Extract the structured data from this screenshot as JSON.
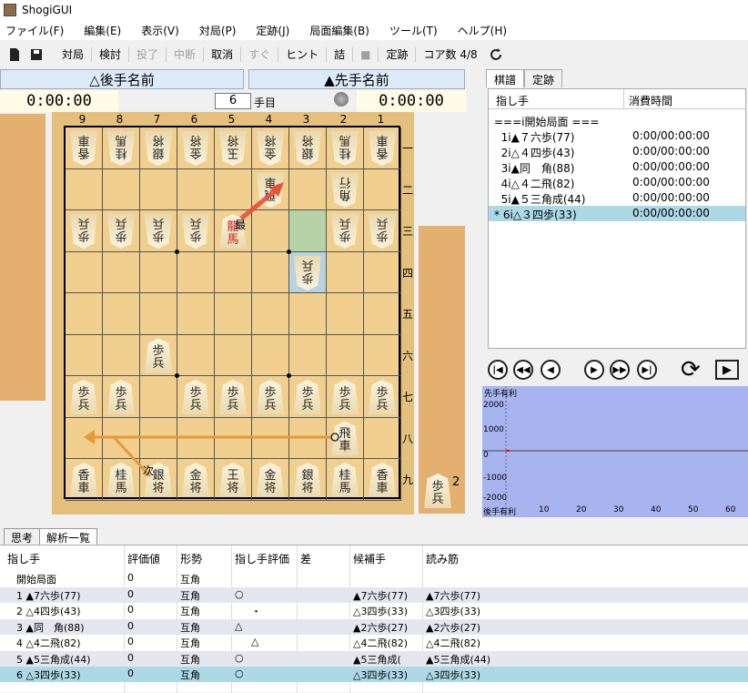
{
  "window": {
    "title": "ShogiGUI"
  },
  "menu": [
    "ファイル(F)",
    "編集(E)",
    "表示(V)",
    "対局(P)",
    "定跡(J)",
    "局面編集(B)",
    "ツール(T)",
    "ヘルプ(H)"
  ],
  "toolbar": {
    "items": [
      {
        "label": "対局",
        "enabled": true
      },
      {
        "label": "検討",
        "enabled": true
      },
      {
        "label": "投了",
        "enabled": false
      },
      {
        "label": "中断",
        "enabled": false
      },
      {
        "label": "取消",
        "enabled": true
      },
      {
        "label": "すぐ",
        "enabled": false
      },
      {
        "label": "ヒント",
        "enabled": true
      },
      {
        "label": "詰",
        "enabled": true
      },
      {
        "label": "■",
        "enabled": false
      },
      {
        "label": "定跡",
        "enabled": true
      }
    ],
    "core_label": "コア数",
    "core_value": "4/8"
  },
  "players": {
    "gote_name": "△後手名前",
    "sente_name": "▲先手名前",
    "gote_time": "0:00:00",
    "sente_time": "0:00:00",
    "move_number": "6",
    "move_suffix": "手目"
  },
  "board": {
    "files": [
      "9",
      "8",
      "7",
      "6",
      "5",
      "4",
      "3",
      "2",
      "1"
    ],
    "ranks": [
      "一",
      "二",
      "三",
      "四",
      "五",
      "六",
      "七",
      "八",
      "九"
    ],
    "pieces": [
      {
        "f": 9,
        "r": 1,
        "t": "香\n車",
        "s": "g"
      },
      {
        "f": 8,
        "r": 1,
        "t": "桂\n馬",
        "s": "g"
      },
      {
        "f": 7,
        "r": 1,
        "t": "銀\n将",
        "s": "g"
      },
      {
        "f": 6,
        "r": 1,
        "t": "金\n将",
        "s": "g"
      },
      {
        "f": 5,
        "r": 1,
        "t": "玉\n将",
        "s": "g"
      },
      {
        "f": 4,
        "r": 1,
        "t": "金\n将",
        "s": "g"
      },
      {
        "f": 3,
        "r": 1,
        "t": "銀\n将",
        "s": "g"
      },
      {
        "f": 2,
        "r": 1,
        "t": "桂\n馬",
        "s": "g"
      },
      {
        "f": 1,
        "r": 1,
        "t": "香\n車",
        "s": "g"
      },
      {
        "f": 4,
        "r": 2,
        "t": "飛\n車",
        "s": "g"
      },
      {
        "f": 2,
        "r": 2,
        "t": "角\n行",
        "s": "g"
      },
      {
        "f": 9,
        "r": 3,
        "t": "歩\n兵",
        "s": "g"
      },
      {
        "f": 8,
        "r": 3,
        "t": "歩\n兵",
        "s": "g"
      },
      {
        "f": 7,
        "r": 3,
        "t": "歩\n兵",
        "s": "g"
      },
      {
        "f": 6,
        "r": 3,
        "t": "歩\n兵",
        "s": "g"
      },
      {
        "f": 5,
        "r": 3,
        "t": "龍\n馬",
        "s": "s",
        "red": true
      },
      {
        "f": 2,
        "r": 3,
        "t": "歩\n兵",
        "s": "g"
      },
      {
        "f": 1,
        "r": 3,
        "t": "歩\n兵",
        "s": "g"
      },
      {
        "f": 3,
        "r": 4,
        "t": "歩\n兵",
        "s": "g"
      },
      {
        "f": 7,
        "r": 6,
        "t": "歩\n兵",
        "s": "s"
      },
      {
        "f": 9,
        "r": 7,
        "t": "歩\n兵",
        "s": "s"
      },
      {
        "f": 8,
        "r": 7,
        "t": "歩\n兵",
        "s": "s"
      },
      {
        "f": 6,
        "r": 7,
        "t": "歩\n兵",
        "s": "s"
      },
      {
        "f": 5,
        "r": 7,
        "t": "歩\n兵",
        "s": "s"
      },
      {
        "f": 4,
        "r": 7,
        "t": "歩\n兵",
        "s": "s"
      },
      {
        "f": 3,
        "r": 7,
        "t": "歩\n兵",
        "s": "s"
      },
      {
        "f": 2,
        "r": 7,
        "t": "歩\n兵",
        "s": "s"
      },
      {
        "f": 1,
        "r": 7,
        "t": "歩\n兵",
        "s": "s"
      },
      {
        "f": 2,
        "r": 8,
        "t": "飛\n車",
        "s": "s"
      },
      {
        "f": 9,
        "r": 9,
        "t": "香\n車",
        "s": "s"
      },
      {
        "f": 8,
        "r": 9,
        "t": "桂\n馬",
        "s": "s"
      },
      {
        "f": 7,
        "r": 9,
        "t": "銀\n将",
        "s": "s"
      },
      {
        "f": 6,
        "r": 9,
        "t": "金\n将",
        "s": "s"
      },
      {
        "f": 5,
        "r": 9,
        "t": "王\n将",
        "s": "s"
      },
      {
        "f": 4,
        "r": 9,
        "t": "金\n将",
        "s": "s"
      },
      {
        "f": 3,
        "r": 9,
        "t": "銀\n将",
        "s": "s"
      },
      {
        "f": 2,
        "r": 9,
        "t": "桂\n馬",
        "s": "s"
      },
      {
        "f": 1,
        "r": 9,
        "t": "香\n車",
        "s": "s"
      }
    ],
    "best_label": "最",
    "next_label": "次",
    "sente_hand": {
      "piece": "歩\n兵",
      "count": "2"
    }
  },
  "kifu": {
    "tabs": [
      "棋譜",
      "定跡"
    ],
    "col_move": "指し手",
    "col_time": "消費時間",
    "rows": [
      {
        "move": "===i開始局面 ===",
        "time": ""
      },
      {
        "move": "  1i▲７六歩(77)",
        "time": "0:00/00:00:00"
      },
      {
        "move": "  2i△４四歩(43)",
        "time": "0:00/00:00:00"
      },
      {
        "move": "  3i▲同　角(88)",
        "time": "0:00/00:00:00"
      },
      {
        "move": "  4i△４二飛(82)",
        "time": "0:00/00:00:00"
      },
      {
        "move": "  5i▲５三角成(44)",
        "time": "0:00/00:00:00"
      },
      {
        "move": "* 6i△３四歩(33)",
        "time": "0:00/00:00:00"
      }
    ]
  },
  "graph": {
    "top_label": "先手有利",
    "bottom_label": "後手有利",
    "y_ticks": [
      "2000",
      "1000",
      "0",
      "-1000",
      "-2000"
    ],
    "x_ticks": [
      "10",
      "20",
      "30",
      "40",
      "50",
      "60"
    ]
  },
  "bottom_tabs": [
    "思考",
    "解析一覧"
  ],
  "analysis": {
    "headers": [
      "指し手",
      "評価値",
      "形勢",
      "指し手評価",
      "差",
      "候補手",
      "読み筋"
    ],
    "rows": [
      {
        "move": "開始局面",
        "eval": "0",
        "status": "互角",
        "mark": "",
        "diff": "",
        "cand": "",
        "pv": ""
      },
      {
        "move": "1 ▲7六歩(77)",
        "eval": "0",
        "status": "互角",
        "mark": "○",
        "diff": "",
        "cand": "▲7六歩(77)",
        "pv": "▲7六歩(77)"
      },
      {
        "move": "2 △4四歩(43)",
        "eval": "0",
        "status": "互角",
        "mark": "・",
        "diff": "",
        "cand": "△3四歩(33)",
        "pv": "△3四歩(33)"
      },
      {
        "move": "3 ▲同　角(88)",
        "eval": "0",
        "status": "互角",
        "mark": "△",
        "diff": "",
        "cand": "▲2六歩(27)",
        "pv": "▲2六歩(27)"
      },
      {
        "move": "4 △4二飛(82)",
        "eval": "0",
        "status": "互角",
        "mark": "△",
        "diff": "",
        "cand": "△4二飛(82)",
        "pv": "△4二飛(82)"
      },
      {
        "move": "5 ▲5三角成(44)",
        "eval": "0",
        "status": "互角",
        "mark": "○",
        "diff": "",
        "cand": "▲5三角成(",
        "pv": "▲5三角成(44)"
      },
      {
        "move": "6 △3四歩(33)",
        "eval": "0",
        "status": "互角",
        "mark": "○",
        "diff": "",
        "cand": "△3四歩(33)",
        "pv": "△3四歩(33)"
      }
    ]
  }
}
